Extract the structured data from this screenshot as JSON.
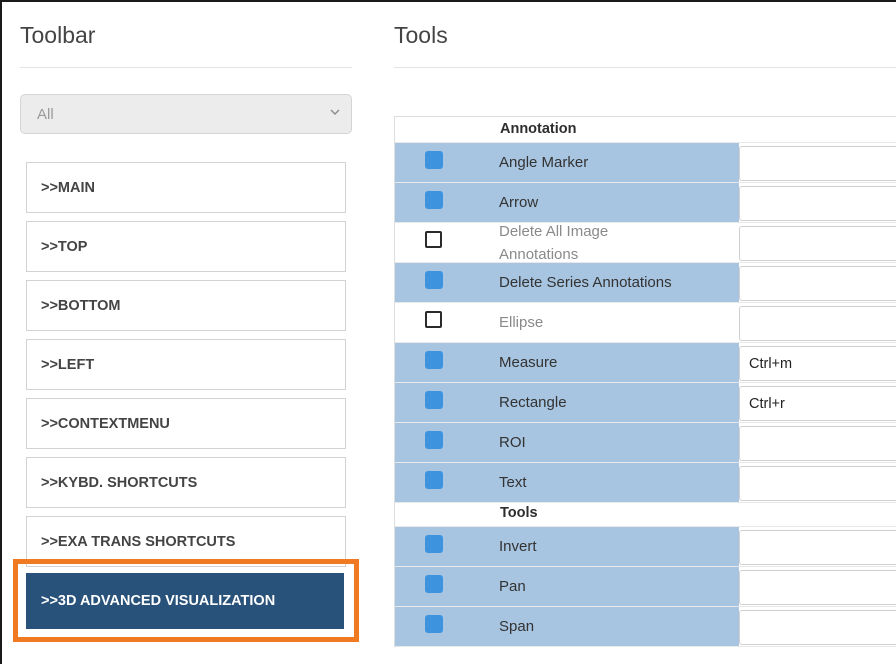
{
  "toolbar": {
    "title": "Toolbar",
    "filter_value": "All",
    "items": [
      {
        "label": ">>MAIN"
      },
      {
        "label": ">>TOP"
      },
      {
        "label": ">>BOTTOM"
      },
      {
        "label": ">>LEFT"
      },
      {
        "label": ">>CONTEXTMENU"
      },
      {
        "label": ">>KYBD. SHORTCUTS"
      },
      {
        "label": ">>EXA TRANS SHORTCUTS"
      }
    ],
    "active_item": ">>3D ADVANCED VISUALIZATION"
  },
  "tools": {
    "title": "Tools",
    "sections": [
      {
        "heading": "Annotation",
        "rows": [
          {
            "label": "Angle Marker",
            "checked": true,
            "shortcut": ""
          },
          {
            "label": "Arrow",
            "checked": true,
            "shortcut": ""
          },
          {
            "label": "Delete All Image Annotations",
            "checked": false,
            "shortcut": ""
          },
          {
            "label": "Delete Series Annotations",
            "checked": true,
            "shortcut": ""
          },
          {
            "label": "Ellipse",
            "checked": false,
            "shortcut": ""
          },
          {
            "label": "Measure",
            "checked": true,
            "shortcut": "Ctrl+m"
          },
          {
            "label": "Rectangle",
            "checked": true,
            "shortcut": "Ctrl+r"
          },
          {
            "label": "ROI",
            "checked": true,
            "shortcut": ""
          },
          {
            "label": "Text",
            "checked": true,
            "shortcut": ""
          }
        ]
      },
      {
        "heading": "Tools",
        "rows": [
          {
            "label": "Invert",
            "checked": true,
            "shortcut": ""
          },
          {
            "label": "Pan",
            "checked": true,
            "shortcut": ""
          },
          {
            "label": "Span",
            "checked": true,
            "shortcut": ""
          }
        ]
      }
    ]
  },
  "colors": {
    "selected_row": "#a7c4e0",
    "checkbox_on": "#3d93de",
    "active_button": "#28527a",
    "highlight_ring": "#f07a22"
  }
}
